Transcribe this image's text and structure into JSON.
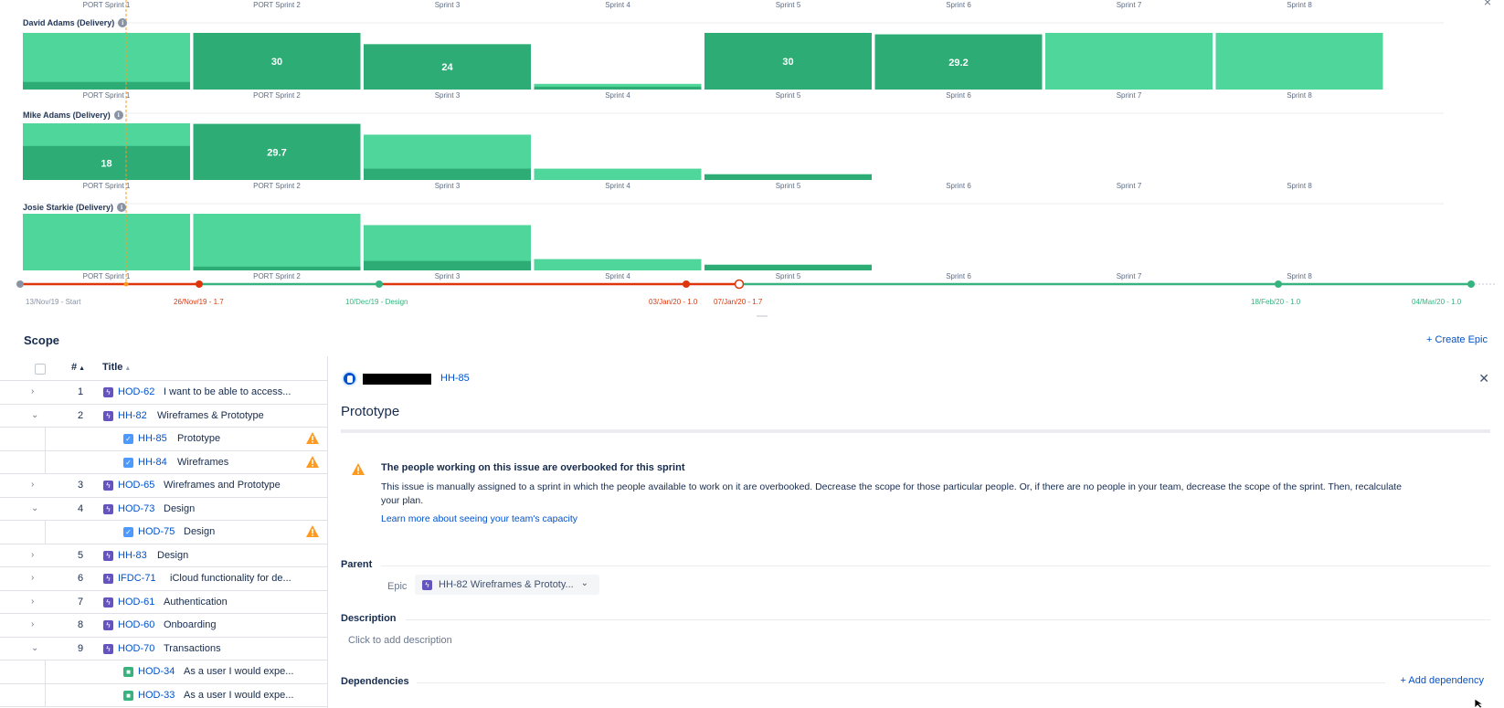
{
  "chart_data": {
    "type": "bar",
    "categories": [
      "PORT Sprint 1",
      "PORT Sprint 2",
      "Sprint 3",
      "Sprint 4",
      "Sprint 5",
      "Sprint 6",
      "Sprint 7",
      "Sprint 8"
    ],
    "ylim": [
      0,
      30
    ],
    "colors": {
      "capacity": "#4fd69b",
      "assigned": "#2eac75"
    },
    "series": [
      {
        "name": "David Adams (Delivery)",
        "capacity": [
          30,
          30,
          24,
          3,
          30,
          29.2,
          30,
          30
        ],
        "assigned": [
          4,
          30,
          24,
          1.5,
          30,
          29.2,
          0,
          0
        ],
        "labels": [
          "",
          "30",
          "24",
          "",
          "30",
          "29.2",
          "",
          ""
        ]
      },
      {
        "name": "Mike Adams (Delivery)",
        "capacity": [
          30,
          29.7,
          24,
          6,
          3,
          0,
          0,
          0
        ],
        "assigned": [
          18,
          29.7,
          6,
          0,
          3,
          0,
          0,
          0
        ],
        "labels": [
          "18",
          "29.7",
          "",
          "",
          "",
          "",
          "",
          ""
        ]
      },
      {
        "name": "Josie Starkie (Delivery)",
        "capacity": [
          30,
          30,
          24,
          6,
          3,
          0,
          0,
          0
        ],
        "assigned": [
          0,
          2,
          5,
          0,
          3,
          0,
          0,
          0
        ],
        "labels": [
          "",
          "",
          "",
          "",
          "",
          "",
          "",
          ""
        ]
      }
    ]
  },
  "timeline": {
    "releases": [
      {
        "label": "13/Nov/19 - Start",
        "status": "start",
        "color": "#8993a4"
      },
      {
        "label": "26/Nov/19 - 1.7",
        "status": "late",
        "color": "#de350b"
      },
      {
        "label": "10/Dec/19 - Design",
        "status": "ok",
        "color": "#36b37e"
      },
      {
        "label": "03/Jan/20 - 1.0",
        "status": "late",
        "color": "#de350b"
      },
      {
        "label": "07/Jan/20 - 1.7",
        "status": "late",
        "color": "#de350b"
      },
      {
        "label": "18/Feb/20 - 1.0",
        "status": "ok",
        "color": "#36b37e"
      },
      {
        "label": "04/Mar/20 - 1.0",
        "status": "ok",
        "color": "#36b37e"
      }
    ]
  },
  "scope": {
    "title": "Scope",
    "create_epic": "+ Create Epic",
    "columns": {
      "num": "#",
      "title": "Title"
    }
  },
  "rows": [
    {
      "num": "1",
      "key": "HOD-62",
      "title": "I want to be able to access...",
      "type": "epic",
      "expanded": false,
      "warn": false
    },
    {
      "num": "2",
      "key": "HH-82",
      "title": "Wireframes & Prototype",
      "type": "epic",
      "expanded": true,
      "warn": false
    },
    {
      "num": "",
      "key": "HH-85",
      "title": "Prototype",
      "type": "task",
      "child": true,
      "warn": true
    },
    {
      "num": "",
      "key": "HH-84",
      "title": "Wireframes",
      "type": "task",
      "child": true,
      "warn": true
    },
    {
      "num": "3",
      "key": "HOD-65",
      "title": "Wireframes and Prototype",
      "type": "epic",
      "expanded": false,
      "warn": false
    },
    {
      "num": "4",
      "key": "HOD-73",
      "title": "Design",
      "type": "epic",
      "expanded": true,
      "warn": false
    },
    {
      "num": "",
      "key": "HOD-75",
      "title": "Design",
      "type": "task",
      "child": true,
      "warn": true
    },
    {
      "num": "5",
      "key": "HH-83",
      "title": "Design",
      "type": "epic",
      "expanded": false,
      "warn": false
    },
    {
      "num": "6",
      "key": "IFDC-71",
      "title": "iCloud functionality for de...",
      "type": "epic",
      "expanded": false,
      "warn": false
    },
    {
      "num": "7",
      "key": "HOD-61",
      "title": "Authentication",
      "type": "epic",
      "expanded": false,
      "warn": false
    },
    {
      "num": "8",
      "key": "HOD-60",
      "title": "Onboarding",
      "type": "epic",
      "expanded": false,
      "warn": false
    },
    {
      "num": "9",
      "key": "HOD-70",
      "title": "Transactions",
      "type": "epic",
      "expanded": true,
      "warn": false
    },
    {
      "num": "",
      "key": "HOD-34",
      "title": "As a user I would expe...",
      "type": "story",
      "child": true,
      "warn": false
    },
    {
      "num": "",
      "key": "HOD-33",
      "title": "As a user I would expe...",
      "type": "story",
      "child": true,
      "warn": false
    }
  ],
  "detail": {
    "issue_key": "HH-85",
    "title": "Prototype",
    "warning": {
      "title": "The people working on this issue are overbooked for this sprint",
      "body": "This issue is manually assigned to a sprint in which the people available to work on it are overbooked. Decrease the scope for those particular people. Or, if there are no people in your team, decrease the scope of the sprint. Then, recalculate your plan.",
      "link": "Learn more about seeing your team's capacity"
    },
    "parent_label": "Parent",
    "epic_label": "Epic",
    "epic_value": "HH-82 Wireframes & Prototy...",
    "description_label": "Description",
    "description_placeholder": "Click to add description",
    "dependencies_label": "Dependencies",
    "add_dependency": "+ Add dependency"
  }
}
